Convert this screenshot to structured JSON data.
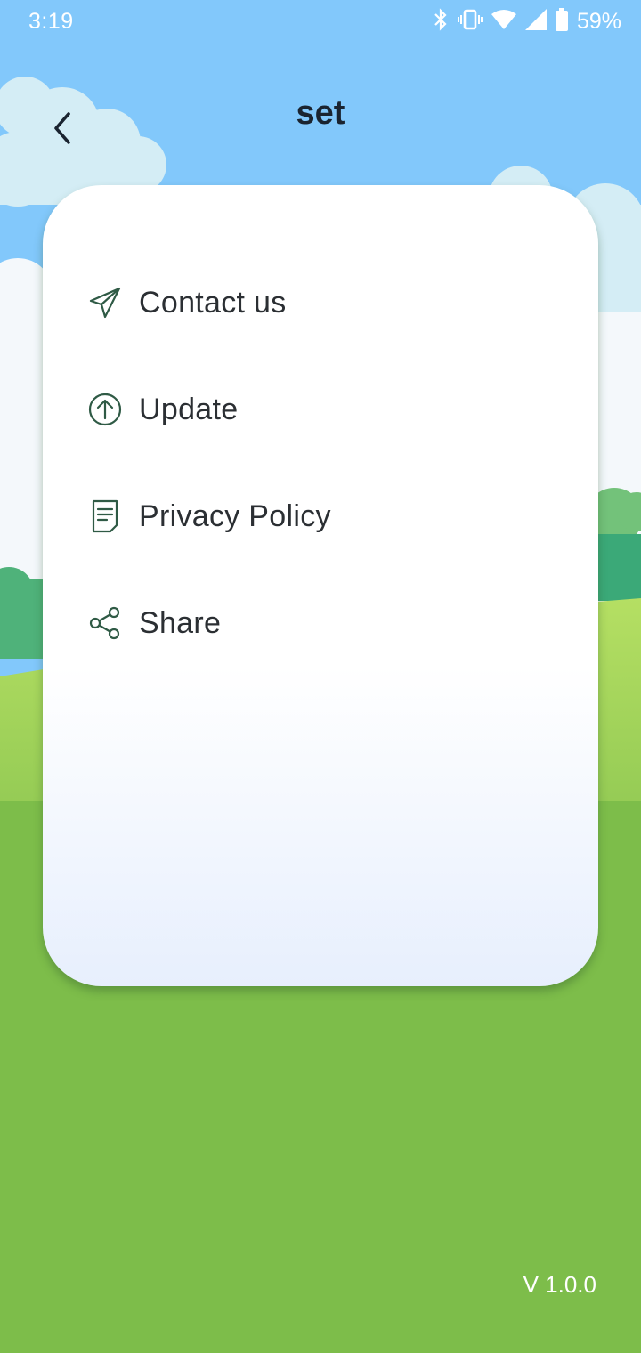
{
  "status_bar": {
    "time": "3:19",
    "battery_percent": "59%",
    "icons": [
      "bluetooth-icon",
      "vibrate-icon",
      "wifi-icon",
      "cell-signal-icon",
      "battery-icon"
    ]
  },
  "header": {
    "title": "set",
    "back_icon": "chevron-left-icon"
  },
  "menu": {
    "items": [
      {
        "label": "Contact us",
        "icon": "send-icon"
      },
      {
        "label": "Update",
        "icon": "arrow-up-circle-icon"
      },
      {
        "label": "Privacy Policy",
        "icon": "document-icon"
      },
      {
        "label": "Share",
        "icon": "share-icon"
      }
    ]
  },
  "footer": {
    "version": "V 1.0.0"
  },
  "colors": {
    "sky": "#82c8fb",
    "grass": "#7dbd4a",
    "icon_stroke": "#2f5a45",
    "text": "#2b2f33"
  }
}
